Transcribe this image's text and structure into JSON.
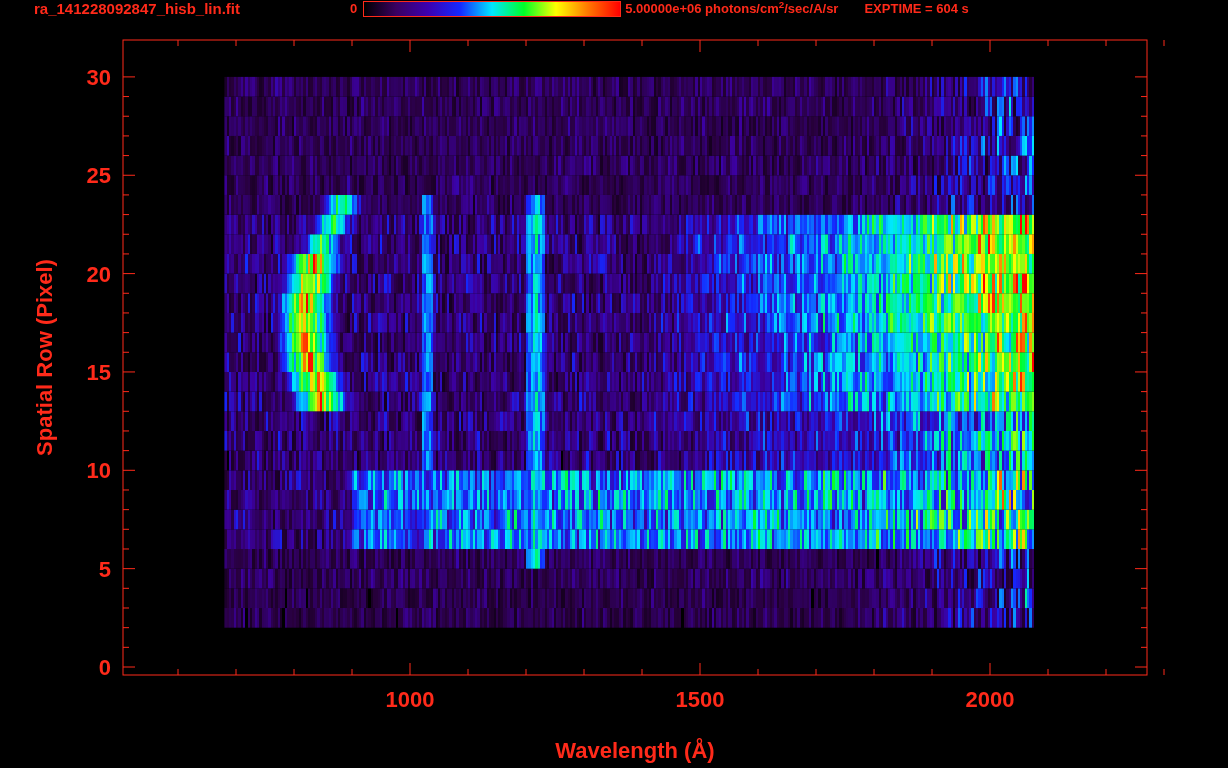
{
  "title": "ra_141228092847_hisb_lin.fit",
  "colorbar": {
    "min_label": "0",
    "max_label": "5.00000e+06 photons/cm$^{2}$/sec/A/sr"
  },
  "exptime": "EXPTIME = 604 s",
  "plot": {
    "xlabel": "Wavelength (Å)",
    "ylabel": "Spatial Row (Pixel)",
    "xticks": [
      "1000",
      "1500",
      "2000"
    ],
    "yticks": [
      "30",
      "25",
      "20",
      "15",
      "10",
      "5",
      "0"
    ]
  }
}
